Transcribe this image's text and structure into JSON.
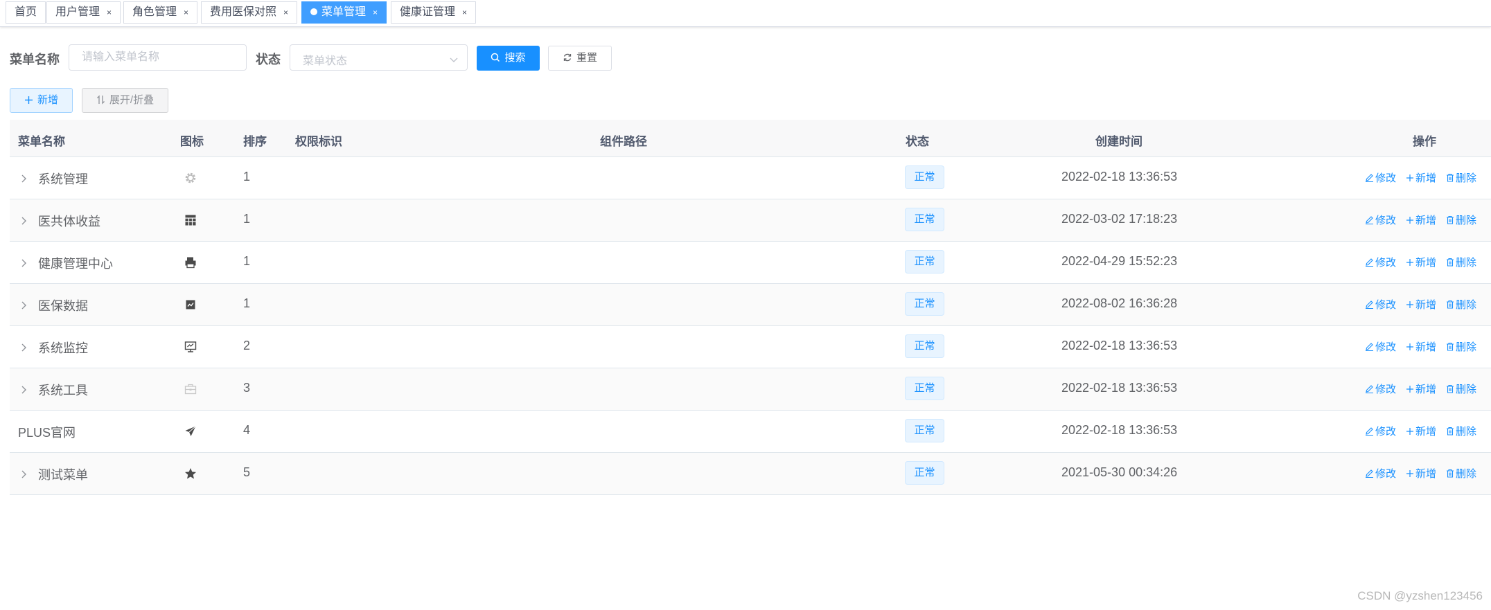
{
  "tabs": [
    {
      "label": "首页",
      "closable": false,
      "active": false
    },
    {
      "label": "用户管理",
      "closable": true,
      "active": false
    },
    {
      "label": "角色管理",
      "closable": true,
      "active": false
    },
    {
      "label": "费用医保对照",
      "closable": true,
      "active": false
    },
    {
      "label": "菜单管理",
      "closable": true,
      "active": true
    },
    {
      "label": "健康证管理",
      "closable": true,
      "active": false
    }
  ],
  "tab_close_glyph": "×",
  "search": {
    "menu_name_label": "菜单名称",
    "menu_name_placeholder": "请输入菜单名称",
    "status_label": "状态",
    "status_placeholder": "菜单状态",
    "search_button": "搜索",
    "reset_button": "重置"
  },
  "toolbar": {
    "add_button": "新增",
    "expand_collapse_button": "展开/折叠"
  },
  "table": {
    "columns": {
      "name": "菜单名称",
      "icon": "图标",
      "order": "排序",
      "perms": "权限标识",
      "component": "组件路径",
      "status": "状态",
      "created": "创建时间",
      "actions": "操作"
    },
    "rows": [
      {
        "name": "系统管理",
        "icon": "gear-icon",
        "order": "1",
        "status": "正常",
        "created": "2022-02-18 13:36:53",
        "expandable": true
      },
      {
        "name": "医共体收益",
        "icon": "table-grid-icon",
        "order": "1",
        "status": "正常",
        "created": "2022-03-02 17:18:23",
        "expandable": true
      },
      {
        "name": "健康管理中心",
        "icon": "printer-icon",
        "order": "1",
        "status": "正常",
        "created": "2022-04-29 15:52:23",
        "expandable": true
      },
      {
        "name": "医保数据",
        "icon": "chart-box-icon",
        "order": "1",
        "status": "正常",
        "created": "2022-08-02 16:36:28",
        "expandable": true
      },
      {
        "name": "系统监控",
        "icon": "monitor-icon",
        "order": "2",
        "status": "正常",
        "created": "2022-02-18 13:36:53",
        "expandable": true
      },
      {
        "name": "系统工具",
        "icon": "toolbox-icon",
        "order": "3",
        "status": "正常",
        "created": "2022-02-18 13:36:53",
        "expandable": true
      },
      {
        "name": "PLUS官网",
        "icon": "paper-plane-icon",
        "order": "4",
        "status": "正常",
        "created": "2022-02-18 13:36:53",
        "expandable": false
      },
      {
        "name": "测试菜单",
        "icon": "star-icon",
        "order": "5",
        "status": "正常",
        "created": "2021-05-30 00:34:26",
        "expandable": true
      }
    ],
    "row_actions": {
      "edit": "修改",
      "add": "新增",
      "delete": "删除"
    }
  },
  "watermark": "CSDN @yzshen123456",
  "colors": {
    "primary": "#1890ff",
    "tag_active": "#409eff",
    "header_bg": "#f8f8f9"
  }
}
